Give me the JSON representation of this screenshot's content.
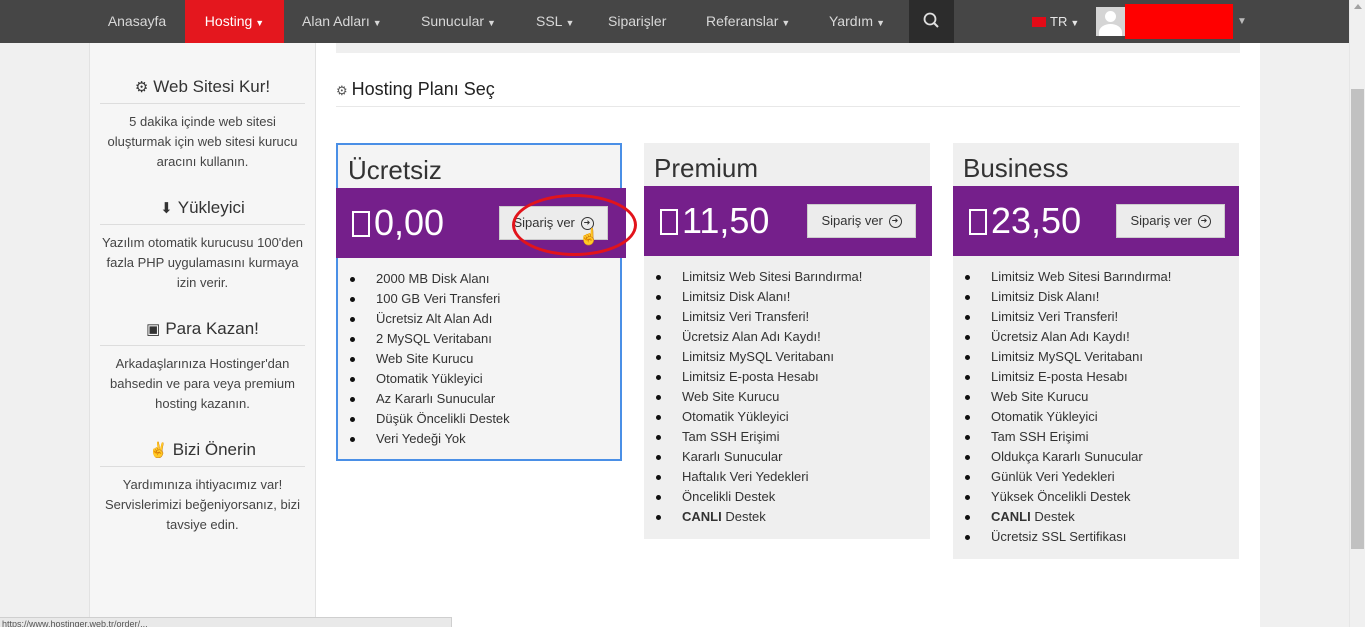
{
  "nav": {
    "items": [
      {
        "label": "Anasayfa",
        "caret": false
      },
      {
        "label": "Hosting",
        "caret": true
      },
      {
        "label": "Alan Adları",
        "caret": true
      },
      {
        "label": "Sunucular",
        "caret": true
      },
      {
        "label": "SSL",
        "caret": true
      },
      {
        "label": "Siparişler",
        "caret": false
      },
      {
        "label": "Referanslar",
        "caret": true
      },
      {
        "label": "Yardım",
        "caret": true
      }
    ],
    "active_index": 1,
    "search_icon": "search-icon",
    "language": "TR",
    "avatar_icon": "user-avatar-icon"
  },
  "sidebar": {
    "sections": [
      {
        "icon": "cogs-icon",
        "title": "Web Sitesi Kur!",
        "text": "5 dakika içinde web sitesi oluşturmak için web sitesi kurucu aracını kullanın."
      },
      {
        "icon": "download-icon",
        "title": "Yükleyici",
        "text": "Yazılım otomatik kurucusu 100'den fazla PHP uygulamasını kurmaya izin verir."
      },
      {
        "icon": "money-icon",
        "title": "Para Kazan!",
        "text": "Arkadaşlarınıza Hostinger'dan bahsedin ve para veya premium hosting kazanın."
      },
      {
        "icon": "thumbs-up-icon",
        "title": "Bizi Önerin",
        "text": "Yardımınıza ihtiyacımız var! Servislerimizi beğeniyorsanız, bizi tavsiye edin."
      }
    ]
  },
  "main": {
    "section_title": "Hosting Planı Seç",
    "section_icon": "cogs-icon",
    "plans": [
      {
        "name": "Ücretsiz",
        "price": "0,00",
        "order_label": "Sipariş ver",
        "selected": true,
        "features": [
          "2000 MB Disk Alanı",
          "100 GB Veri Transferi",
          "Ücretsiz Alt Alan Adı",
          "2 MySQL Veritabanı",
          "Web Site Kurucu",
          "Otomatik Yükleyici",
          "Az Kararlı Sunucular",
          "Düşük Öncelikli Destek",
          "Veri Yedeği Yok"
        ]
      },
      {
        "name": "Premium",
        "price": "11,50",
        "order_label": "Sipariş ver",
        "selected": false,
        "features": [
          "Limitsiz Web Sitesi Barındırma!",
          "Limitsiz Disk Alanı!",
          "Limitsiz Veri Transferi!",
          "Ücretsiz Alan Adı Kaydı!",
          "Limitsiz MySQL Veritabanı",
          "Limitsiz E-posta Hesabı",
          "Web Site Kurucu",
          "Otomatik Yükleyici",
          "Tam SSH Erişimi",
          "Kararlı Sunucular",
          "Haftalık Veri Yedekleri",
          "Öncelikli Destek",
          "CANLI|Destek"
        ]
      },
      {
        "name": "Business",
        "price": "23,50",
        "order_label": "Sipariş ver",
        "selected": false,
        "features": [
          "Limitsiz Web Sitesi Barındırma!",
          "Limitsiz Disk Alanı!",
          "Limitsiz Veri Transferi!",
          "Ücretsiz Alan Adı Kaydı!",
          "Limitsiz MySQL Veritabanı",
          "Limitsiz E-posta Hesabı",
          "Web Site Kurucu",
          "Otomatik Yükleyici",
          "Tam SSH Erişimi",
          "Oldukça Kararlı Sunucular",
          "Günlük Veri Yedekleri",
          "Yüksek Öncelikli Destek",
          "CANLI|Destek",
          "Ücretsiz SSL Sertifikası"
        ]
      }
    ]
  },
  "colors": {
    "nav_bg": "#464646",
    "nav_active": "#e4171e",
    "plan_bar": "#751f8b",
    "selected_border": "#4a8fe6",
    "annotation": "#e2141b"
  },
  "status_bar": "https://www.hostinger.web.tr/order/..."
}
